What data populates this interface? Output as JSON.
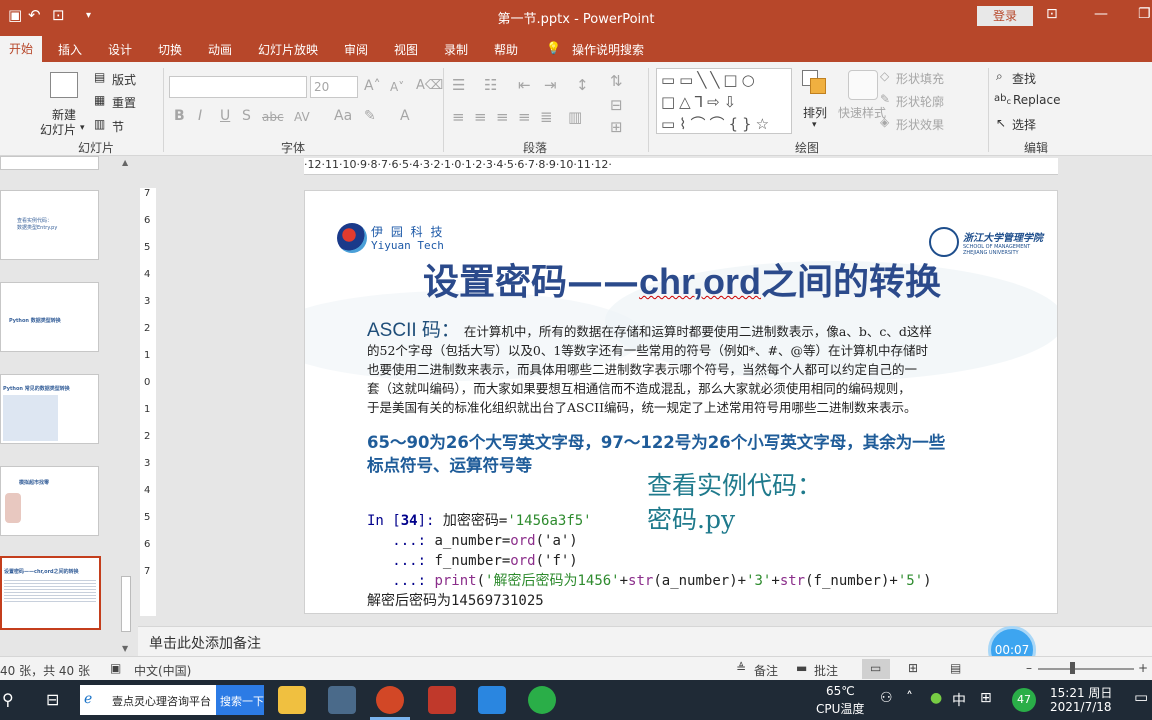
{
  "window": {
    "title": "第一节.pptx  -  PowerPoint",
    "login": "登录"
  },
  "tabs": [
    "开始",
    "插入",
    "设计",
    "切换",
    "动画",
    "幻灯片放映",
    "审阅",
    "视图",
    "录制",
    "帮助"
  ],
  "tell_me": "操作说明搜索",
  "ribbon": {
    "slides": {
      "new_slide": "新建",
      "new_slide2": "幻灯片",
      "layout": "版式",
      "reset": "重置",
      "section": "节",
      "group": "幻灯片"
    },
    "font": {
      "size": "20",
      "group": "字体",
      "bold": "B",
      "italic": "I",
      "underline": "U",
      "strike": "S",
      "abc": "abc",
      "av": "AV",
      "aa": "Aa",
      "a": "A"
    },
    "paragraph": {
      "group": "段落"
    },
    "drawing": {
      "arrange": "排列",
      "quick_styles": "快速样式",
      "fill": "形状填充",
      "outline": "形状轮廓",
      "effects": "形状效果",
      "group": "绘图"
    },
    "editing": {
      "find": "查找",
      "replace": "Replace",
      "select": "选择",
      "group": "编辑"
    }
  },
  "ruler_text": "·12·11·10·9·8·7·6·5·4·3·2·1·0·1·2·3·4·5·6·7·8·9·10·11·12·",
  "vruler": [
    "7",
    "6",
    "5",
    "4",
    "3",
    "2",
    "1",
    "0",
    "1",
    "2",
    "3",
    "4",
    "5",
    "6",
    "7"
  ],
  "thumbnails": [
    {
      "text": "查看实例代码：\n数据类型Entry.py"
    },
    {
      "text": "Python 数据类型转换"
    },
    {
      "text": "Python 常见的数据类型转换"
    },
    {
      "text": "模拟超市找零"
    },
    {
      "text": "设置密码——chr,ord之间的转换"
    }
  ],
  "slide": {
    "logo_cn": "伊 园 科 技",
    "logo_en": "Yiyuan Tech",
    "zju_cn": "浙江大学管理学院",
    "zju_en1": "SCHOOL OF MANAGEMENT",
    "zju_en2": "ZHEJIANG UNIVERSITY",
    "title_a": "设置密码——",
    "title_b": "chr,ord",
    "title_c": "之间的转换",
    "ascii_head": "ASCII 码：",
    "para1": "在计算机中，所有的数据在存储和运算时都要使用二进制数表示，像a、b、c、d这样",
    "para2": "的52个字母（包括大写）以及0、1等数字还有一些常用的符号（例如*、#、@等）在计算机中存储时",
    "para3": "也要使用二进制数来表示，而具体用哪些二进制数字表示哪个符号，当然每个人都可以约定自己的一",
    "para4": "套（这就叫编码），而大家如果要想互相通信而不造成混乱，那么大家就必须使用相同的编码规则，",
    "para5": "于是美国有关的标准化组织就出台了ASCII编码，统一规定了上述常用符号用哪些二进制数来表示。",
    "blue1": "65～90为26个大写英文字母，97～122号为26个小写英文字母，其余为一些",
    "blue2": "标点符号、运算符号等",
    "code_prompt": "In [",
    "code_num": "34",
    "code_prompt_end": "]: ",
    "code1_a": "加密密码=",
    "code1_b": "'1456a3f5'",
    "cont": "   ...: ",
    "code2_a": "a_number=",
    "code2_b": "ord",
    "code2_c": "('a')",
    "code3_a": "f_number=",
    "code3_b": "ord",
    "code3_c": "('f')",
    "code4_print": "print",
    "code4_a": "(",
    "code4_s1": "'解密后密码为1456'",
    "code4_plus": "+",
    "code4_str": "str",
    "code4_an": "(a_number)",
    "code4_s2": "'3'",
    "code4_fn": "(f_number)",
    "code4_s3": "'5'",
    "code4_end": ")",
    "output": "解密后密码为14569731025",
    "view_code1": "查看实例代码：",
    "view_code2": "密码.py"
  },
  "notes_placeholder": "单击此处添加备注",
  "status": {
    "slide_count": "40 张，共 40 张",
    "language": "中文(中国)",
    "notes": "备注",
    "comments": "批注"
  },
  "timer": "00:07",
  "taskbar": {
    "search_text": "壹点灵心理咨询平台",
    "search_btn": "搜索一下",
    "temp": "65℃",
    "temp_label": "CPU温度",
    "ime": "中",
    "badge": "47",
    "time": "15:21 周日",
    "date": "2021/7/18"
  },
  "colors": {
    "accent": "#b7472a",
    "slide_blue": "#1f4e79",
    "title_blue": "#2b4a8b"
  }
}
